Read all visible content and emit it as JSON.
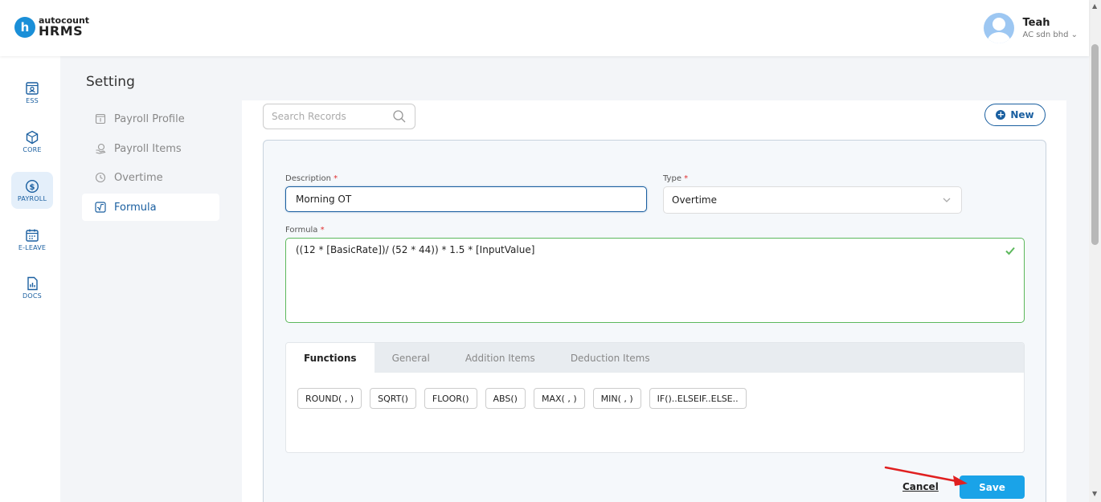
{
  "header": {
    "logo_small": "autocount",
    "logo_big": "HRMS",
    "logo_letter": "h",
    "user_name": "Teah",
    "user_company": "AC sdn bhd"
  },
  "nav": [
    {
      "label": "ESS",
      "icon": "user-card-icon"
    },
    {
      "label": "CORE",
      "icon": "cube-icon"
    },
    {
      "label": "PAYROLL",
      "icon": "dollar-circle-icon"
    },
    {
      "label": "E-LEAVE",
      "icon": "calendar-icon"
    },
    {
      "label": "DOCS",
      "icon": "document-chart-icon"
    }
  ],
  "settings": {
    "title": "Setting",
    "menu": [
      {
        "label": "Payroll Profile"
      },
      {
        "label": "Payroll Items"
      },
      {
        "label": "Overtime"
      },
      {
        "label": "Formula"
      }
    ]
  },
  "toolbar": {
    "search_placeholder": "Search Records",
    "new_label": "New"
  },
  "form": {
    "description_label": "Description",
    "description_value": "Morning OT",
    "type_label": "Type",
    "type_value": "Overtime",
    "formula_label": "Formula",
    "formula_value": "((12 * [BasicRate])/ (52 * 44)) * 1.5 * [InputValue]",
    "required_mark": "*"
  },
  "functions": {
    "tabs": [
      "Functions",
      "General",
      "Addition Items",
      "Deduction Items"
    ],
    "buttons": [
      "ROUND( , )",
      "SQRT()",
      "FLOOR()",
      "ABS()",
      "MAX( , )",
      "MIN( , )",
      "IF()..ELSEIF..ELSE.."
    ]
  },
  "actions": {
    "cancel_label": "Cancel",
    "save_label": "Save"
  },
  "colors": {
    "primary": "#1a5fa0",
    "save": "#1aa3e8",
    "valid": "#5cb85c",
    "arrow": "#e02020"
  }
}
